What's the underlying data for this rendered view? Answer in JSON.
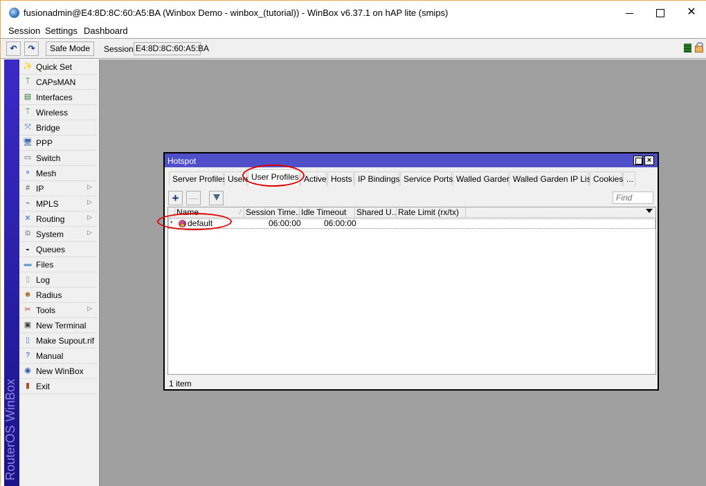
{
  "window": {
    "title": "fusionadmin@E4:8D:8C:60:A5:BA (Winbox Demo - winbox_(tutorial)) - WinBox v6.37.1 on hAP lite (smips)",
    "controls": {
      "minimize": "",
      "maximize": "",
      "close": "✕"
    }
  },
  "menubar": {
    "items": [
      "Session",
      "Settings",
      "Dashboard"
    ]
  },
  "toolbar": {
    "undo": "↶",
    "redo": "↷",
    "safe_mode": "Safe Mode",
    "session_label": "Session:",
    "session_value": "E4:8D:8C:60:A5:BA"
  },
  "sidebar": {
    "brand": "RouterOS WinBox",
    "items": [
      {
        "label": "Quick Set",
        "icon": "wand-icon",
        "submenu": false
      },
      {
        "label": "CAPsMAN",
        "icon": "antenna-icon",
        "submenu": false
      },
      {
        "label": "Interfaces",
        "icon": "network-card-icon",
        "submenu": false
      },
      {
        "label": "Wireless",
        "icon": "antenna-icon",
        "submenu": false
      },
      {
        "label": "Bridge",
        "icon": "bridge-icon",
        "submenu": false
      },
      {
        "label": "PPP",
        "icon": "ppp-icon",
        "submenu": false
      },
      {
        "label": "Switch",
        "icon": "switch-icon",
        "submenu": false
      },
      {
        "label": "Mesh",
        "icon": "mesh-icon",
        "submenu": false
      },
      {
        "label": "IP",
        "icon": "ip-icon",
        "submenu": true
      },
      {
        "label": "MPLS",
        "icon": "tag-icon",
        "submenu": true
      },
      {
        "label": "Routing",
        "icon": "routing-icon",
        "submenu": true
      },
      {
        "label": "System",
        "icon": "gear-icon",
        "submenu": true
      },
      {
        "label": "Queues",
        "icon": "gauge-icon",
        "submenu": false
      },
      {
        "label": "Files",
        "icon": "folder-icon",
        "submenu": false
      },
      {
        "label": "Log",
        "icon": "document-icon",
        "submenu": false
      },
      {
        "label": "Radius",
        "icon": "users-icon",
        "submenu": false
      },
      {
        "label": "Tools",
        "icon": "tools-icon",
        "submenu": true
      },
      {
        "label": "New Terminal",
        "icon": "terminal-icon",
        "submenu": false
      },
      {
        "label": "Make Supout.rif",
        "icon": "file-export-icon",
        "submenu": false
      },
      {
        "label": "Manual",
        "icon": "help-icon",
        "submenu": false
      },
      {
        "label": "New WinBox",
        "icon": "winbox-icon",
        "submenu": false
      },
      {
        "label": "Exit",
        "icon": "exit-door-icon",
        "submenu": false
      }
    ],
    "submenu_arrow": "▷"
  },
  "hotspot": {
    "title": "Hotspot",
    "tabs": [
      "Server Profiles",
      "Users",
      "User Profiles",
      "Active",
      "Hosts",
      "IP Bindings",
      "Service Ports",
      "Walled Garden",
      "Walled Garden IP List",
      "Cookies",
      "..."
    ],
    "active_tab": "User Profiles",
    "add": "+",
    "remove": "—",
    "find_placeholder": "Find",
    "columns": [
      "Name",
      "Session Time...",
      "Idle Timeout",
      "Shared U...",
      "Rate Limit (rx/tx)"
    ],
    "sort_indicator": "⁄",
    "rows": [
      {
        "flag": "*",
        "name": "default",
        "session_timeout": "06:00:00",
        "idle_timeout": "06:00:00",
        "shared_users": "",
        "rate_limit": ""
      }
    ],
    "status": "1 item"
  },
  "annotations": {
    "color": "#e00000"
  }
}
